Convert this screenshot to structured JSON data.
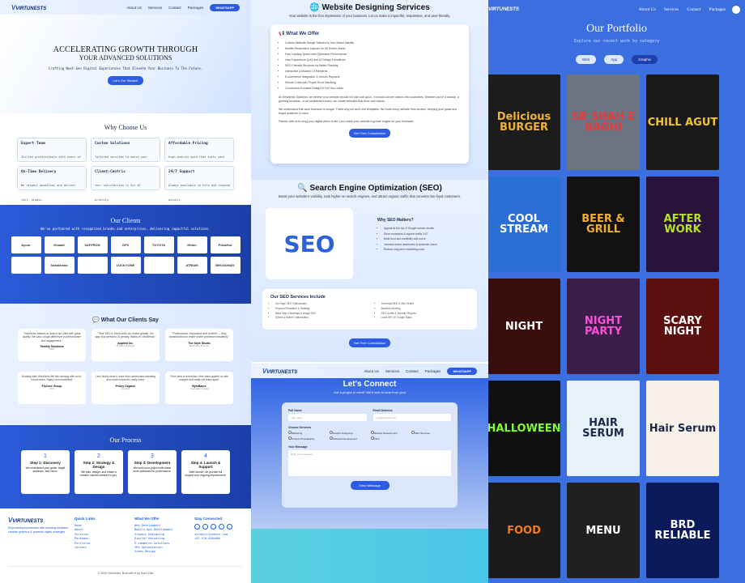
{
  "brand": {
    "name": "VIRTUNESTS",
    "tag": "SOLUTIONS"
  },
  "nav": {
    "links": [
      "About Us",
      "Services",
      "Contact",
      "Packages"
    ],
    "cta": "WHATSAPP"
  },
  "hero": {
    "line1": "ACCELERATING GROWTH THROUGH",
    "line2": "YOUR ADVANCED SOLUTIONS",
    "tagline": "Crafting Next-Gen Digital Experiences That Elevate Your Business To The Future.",
    "button": "Let's Get Started!"
  },
  "why": {
    "title": "Why Choose Us",
    "cards": [
      {
        "t": "Expert Team",
        "d": "Skilled professionals with years of real-world experience."
      },
      {
        "t": "Custom Solutions",
        "d": "Tailored services to match your unique business goals."
      },
      {
        "t": "Affordable Pricing",
        "d": "High-quality work that suits your budget."
      },
      {
        "t": "On-Time Delivery",
        "d": "We respect deadlines and deliver fast, always."
      },
      {
        "t": "Client-Centric",
        "d": "Your satisfaction is our #1 priority."
      },
      {
        "t": "24/7 Support",
        "d": "Always available to help and respond quickly."
      }
    ]
  },
  "clients": {
    "title": "Our Clients",
    "sub": "We've partnered with recognized brands and enterprises, delivering impactful solutions.",
    "logos": [
      "Ayoor",
      "Khaadi",
      "SAFFRON",
      "GFS",
      "TOYOTA",
      "Hilton",
      "PizzaHut",
      "",
      "Sakakhana",
      "",
      "LUCKYONE",
      "",
      "ATRIUM",
      "BROADWAY"
    ]
  },
  "testi": {
    "title": "What Our Clients Say",
    "items": [
      {
        "q": "\"VirtuNests helped us launch our sites with great quality. We saw a huge difference in performance and engagement.\"",
        "n": "Twinkly Solutions",
        "r": "CEO"
      },
      {
        "q": "\"Their SEO & Socal skills our online greatly. Our app now performs 3x greatly, thanks to VirtuNests!\"",
        "n": "Applied Inc.",
        "r": "Product Manager"
      },
      {
        "q": "\"Professional, responsive and creative — they transformed our entire online presence beautifully.\"",
        "n": "The Style Studio",
        "r": "Marketing Director"
      },
      {
        "q": "Working with VirtuNests felt like working with an in-house team. Highly recommended!",
        "n": "FinCore Group",
        "r": "CTO"
      },
      {
        "q": "Let's finally done it more than understand branding and what customers really need.",
        "n": "Penny Organic",
        "r": "Founder"
      },
      {
        "q": "From idea to execution, their team guided us with insights that really set them apart.",
        "n": "ByteBaure",
        "r": "Operations Head"
      }
    ]
  },
  "process": {
    "title": "Our Process",
    "steps": [
      {
        "n": "1",
        "t": "Step 1: Discovery",
        "d": "We understand your goals, target audience, and vision."
      },
      {
        "n": "2",
        "t": "Step 2: Strategy & Design",
        "d": "We plan, design, and create a modern solution tailored to you."
      },
      {
        "n": "3",
        "t": "Step 3: Development",
        "d": "We build your project with latest tools optimized for performance."
      },
      {
        "n": "4",
        "t": "Step 4: Launch & Support",
        "d": "After launch, we provide full support and ongoing improvement."
      }
    ]
  },
  "footer": {
    "desc": "Empowering businesses with stunning websites, creative graphics & powerful digital strategies.",
    "quick": "Quick Links",
    "quickItems": [
      "Home",
      "About",
      "Services",
      "Packages",
      "Portfolio",
      "Contact"
    ],
    "offer": "What We Offer",
    "offerItems": [
      "Web Development",
      "Mobile App Development",
      "Graphic Designing",
      "Digital Marketing",
      "E-commerce Solutions",
      "SEO Optimization",
      "Video Design"
    ],
    "stay": "Stay Connected",
    "email": "info@virtunests.com",
    "phone": "+92 370 6504600",
    "copy": "© 2025 VirtuNests. Built with ♥ by Syed Zabi"
  },
  "web": {
    "title": "Website Designing Services",
    "sub": "Your website is the first impression of your business. Let us make it impactful, responsive, and user-friendly.",
    "offerTitle": "What We Offer",
    "list": [
      "Custom Website Design Tailored to Your Brand Identity",
      "Mobile-Responsive Layouts for All Screen Sizes",
      "Fast Loading Speed with Optimized Performance",
      "User Experience (UX) and UI Design Excellence",
      "SEO-Friendly Structure for Better Ranking",
      "Interactive & Modern UI Elements",
      "E-commerce Integration & Secure Payment",
      "Secure Code with Proper Error Handling",
      "Conversion-Focused Design to Get You Leads"
    ],
    "p1": "At VirtuNests Solutions, we believe your website should not just look good - it should convert visitors into customers. Whether you're a startup, a growing business, or an established brand, we create websites that drive real results.",
    "p2": "We understand that each business is unique. That's why we don't use templates. We build every website from scratch, keeping your goals and target audience in mind.",
    "p3": "Partner with us to bring your digital vision to life. Let's make your website a growth engine for your business!",
    "button": "Get Free Consultation"
  },
  "seo": {
    "title": "Search Engine Optimization (SEO)",
    "sub": "Boost your website's visibility, rank higher on search engines, and attract organic traffic that converts into loyal customers.",
    "img": "SEO",
    "whyTitle": "Why SEO Matters?",
    "why": [
      "Appear at the top of Google search results",
      "Drive consistent & organic traffic 24/7",
      "Build trust and credibility with users",
      "Increase brand awareness & customer reach",
      "Reduce long-term marketing costs"
    ],
    "inclTitle": "Our SEO Services Include",
    "incl": [
      "On-Page SEO Optimization",
      "Keyword Research & Strategy",
      "Meta Tags, Headings & Image SEO",
      "Speed & Mobile Optimization",
      "Technical SEO & Site Health",
      "Backlink Building",
      "SEO Audits & Monthly Reports",
      "Local SEO & Google Maps"
    ],
    "button": "Get Free Consultation"
  },
  "contact": {
    "title": "Let's Connect",
    "sub": "Got a project in mind? We'd love to hear from you!",
    "name": "Full Name",
    "namePh": "Your name",
    "email": "Email Address",
    "emailPh": "you@example.com",
    "services": "Choose Services",
    "checks": [
      "Marketing",
      "Graphic Designing",
      "Website Development",
      "SEO Services",
      "Product Photography",
      "Software Development",
      "Other"
    ],
    "msg": "Your Message",
    "msgPh": "Write your message...",
    "send": "Send Message"
  },
  "portfolio": {
    "title": "Our Portfolio",
    "sub": "Explore our recent work by category",
    "tabs": [
      "Web",
      "App",
      "Graphic"
    ],
    "active": "Graphic",
    "items": [
      {
        "t": "Delicious BURGER",
        "bg": "#1c1c1c",
        "fg": "#f2b233"
      },
      {
        "t": "SB SHAH E BAGHI",
        "bg": "#6b7480",
        "fg": "#e63b3b"
      },
      {
        "t": "CHILL AGUT",
        "bg": "#1a1a1a",
        "fg": "#f4c430"
      },
      {
        "t": "COOL STREAM",
        "bg": "#2a6fd6",
        "fg": "#ffffff"
      },
      {
        "t": "BEER & GRILL",
        "bg": "#121212",
        "fg": "#f3b02b"
      },
      {
        "t": "AFTER WORK",
        "bg": "#2a123d",
        "fg": "#b5e61d"
      },
      {
        "t": "NIGHT",
        "bg": "#3a0d0d",
        "fg": "#ffffff"
      },
      {
        "t": "NIGHT PARTY",
        "bg": "#3b1d4a",
        "fg": "#ff4fd8"
      },
      {
        "t": "SCARY NIGHT",
        "bg": "#5b0f0f",
        "fg": "#ffffff"
      },
      {
        "t": "HALLOWEEN",
        "bg": "#101010",
        "fg": "#7dff2a"
      },
      {
        "t": "HAIR SERUM",
        "bg": "#e6f2f7",
        "fg": "#1a2a4a"
      },
      {
        "t": "Hair Serum",
        "bg": "#f6f0e8",
        "fg": "#1a2a4a"
      },
      {
        "t": "FOOD",
        "bg": "#1b1b1b",
        "fg": "#f07d1d"
      },
      {
        "t": "MENU",
        "bg": "#202020",
        "fg": "#ffffff"
      },
      {
        "t": "BRD RELIABLE",
        "bg": "#0b1a5a",
        "fg": "#ffffff"
      }
    ]
  }
}
